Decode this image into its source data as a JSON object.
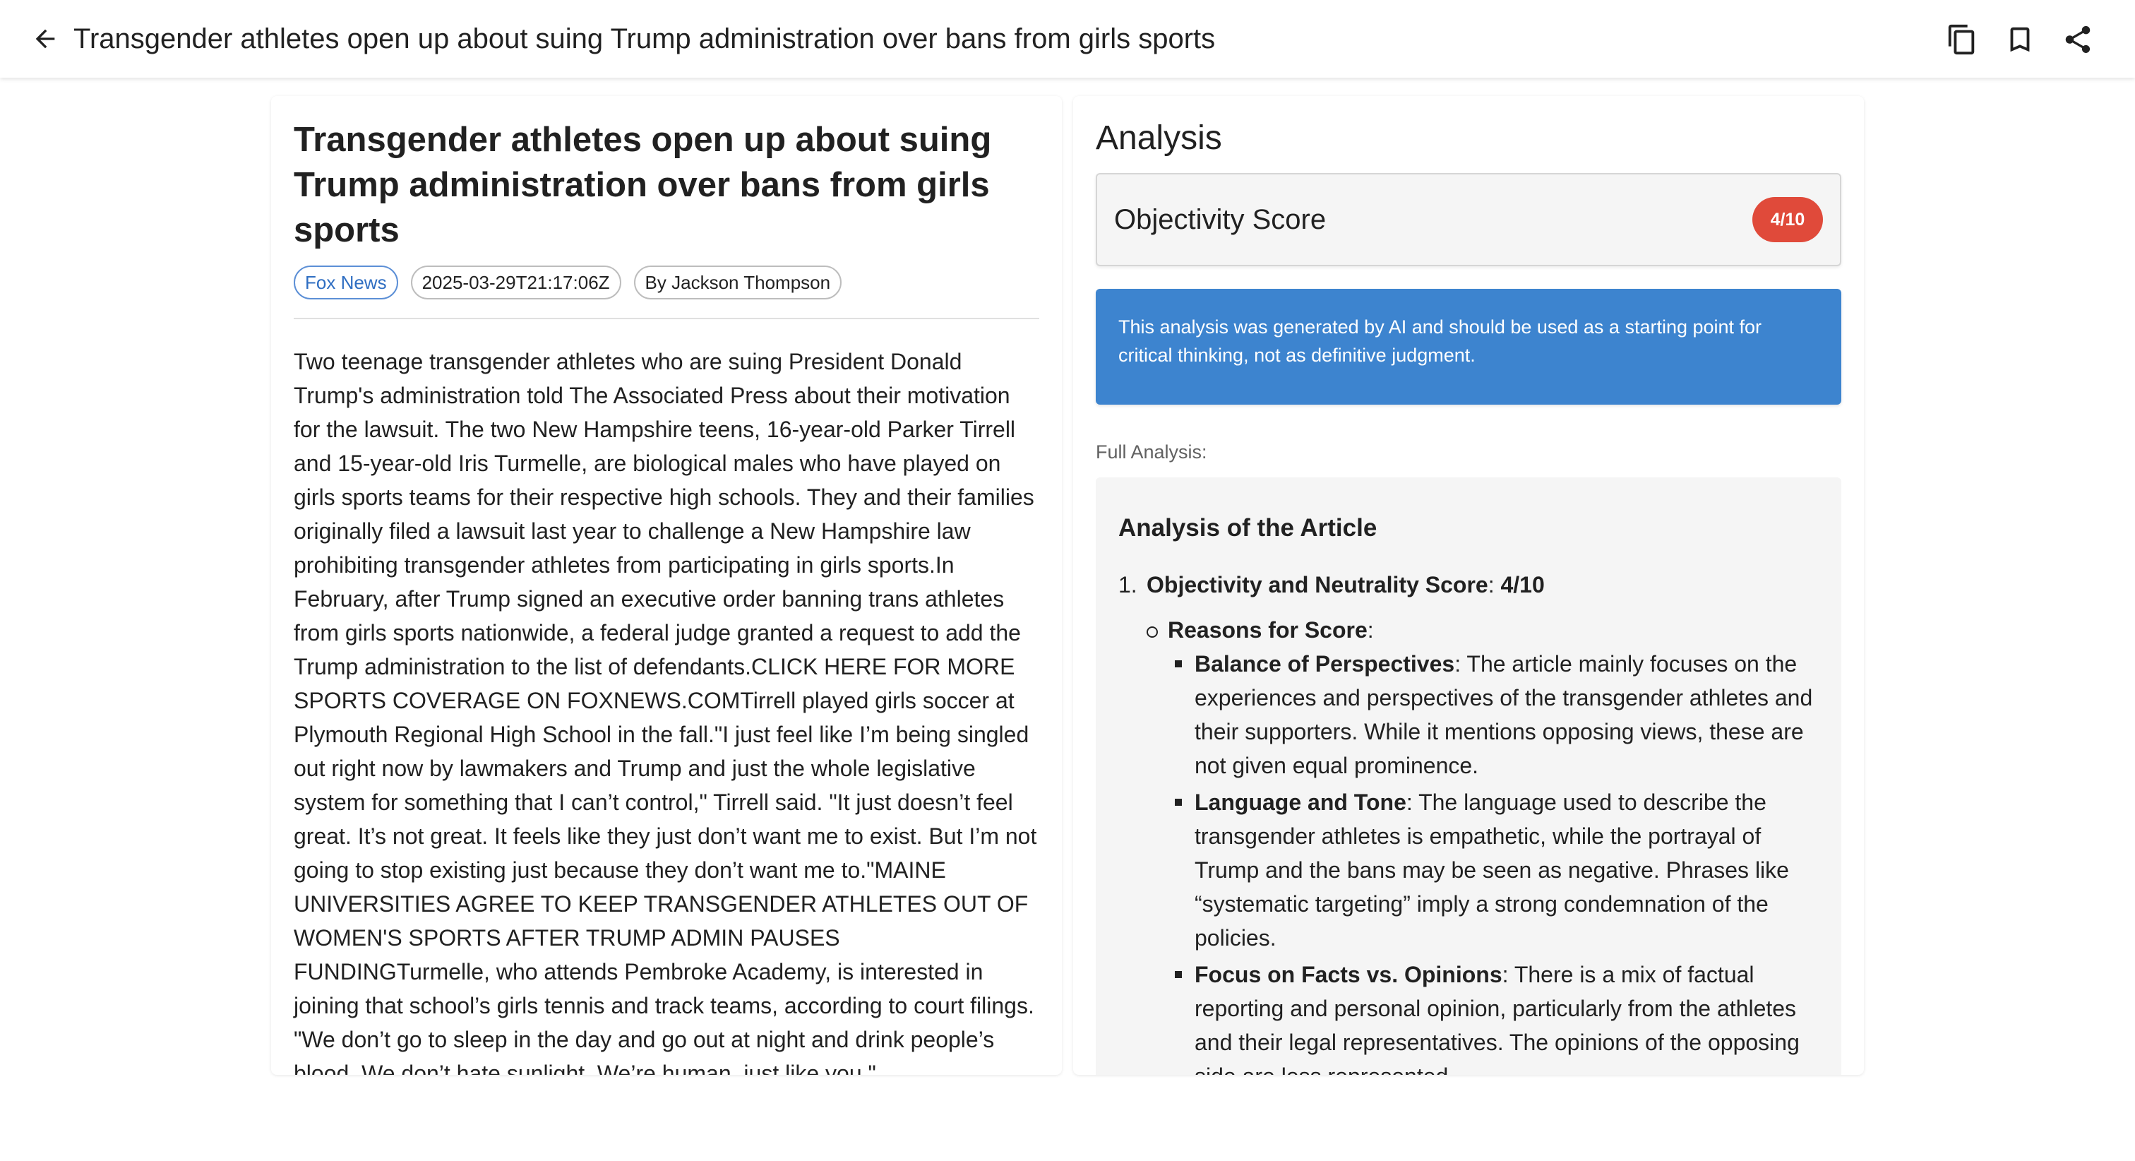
{
  "appbar": {
    "title": "Transgender athletes open up about suing Trump administration over bans from girls sports",
    "back_icon": "arrow-left-icon",
    "actions": [
      "copy-icon",
      "bookmark-icon",
      "share-icon"
    ]
  },
  "article": {
    "title": "Transgender athletes open up about suing Trump administration over bans from girls sports",
    "source": "Fox News",
    "date": "2025-03-29T21:17:06Z",
    "author": "By Jackson Thompson",
    "body": "Two teenage transgender athletes who are suing President Donald Trump's administration told The Associated Press about their motivation for the lawsuit. The two New Hampshire teens, 16-year-old Parker Tirrell and 15-year-old Iris Turmelle, are biological males who have played on girls sports teams for their respective high schools. They and their families originally filed a lawsuit last year to challenge a New Hampshire law prohibiting transgender athletes from participating in girls sports.In February, after Trump signed an executive order banning trans athletes from girls sports nationwide, a federal judge granted a request to add the Trump administration to the list of defendants.CLICK HERE FOR MORE SPORTS COVERAGE ON FOXNEWS.COMTirrell played girls soccer at Plymouth Regional High School in the fall.\"I just feel like I’m being singled out right now by lawmakers and Trump and just the whole legislative system for something that I can’t control,\" Tirrell said. \"It just doesn’t feel great. It’s not great. It feels like they just don’t want me to exist. But I’m not going to stop existing just because they don’t want me to.\"MAINE UNIVERSITIES AGREE TO KEEP TRANSGENDER ATHLETES OUT OF WOMEN'S SPORTS AFTER TRUMP ADMIN PAUSES FUNDINGTurmelle, who attends Pembroke Academy, is interested in joining that school’s girls tennis and track teams, according to court filings. \"We don’t go to sleep in the day and go out at night and drink people’s blood. We don’t hate sunlight. We’re human, just like you.\""
  },
  "analysis": {
    "heading": "Analysis",
    "score_label": "Objectivity Score",
    "score_value": "4/10",
    "notice": "This analysis was generated by AI and should be used as a starting point for critical thinking, not as definitive judgment.",
    "full_label": "Full Analysis:",
    "full_title": "Analysis of the Article",
    "item1_num": "1.",
    "item1_label": "Objectivity and Neutrality Score",
    "item1_sep": ":",
    "item1_value": "4/10",
    "reasons_label": "Reasons for Score",
    "reasons_sep": ":",
    "points": [
      {
        "label": "Balance of Perspectives",
        "text": ": The article mainly focuses on the experiences and perspectives of the transgender athletes and their supporters. While it mentions opposing views, these are not given equal prominence."
      },
      {
        "label": "Language and Tone",
        "text": ": The language used to describe the transgender athletes is empathetic, while the portrayal of Trump and the bans may be seen as negative. Phrases like “systematic targeting” imply a strong condemnation of the policies."
      },
      {
        "label": "Focus on Facts vs. Opinions",
        "text": ": There is a mix of factual reporting and personal opinion, particularly from the athletes and their legal representatives. The opinions of the opposing side are less represented."
      }
    ]
  },
  "colors": {
    "score_badge": "#e04a3a",
    "notice_bg": "#3d84cf",
    "source_chip": "#2f6ec2"
  }
}
